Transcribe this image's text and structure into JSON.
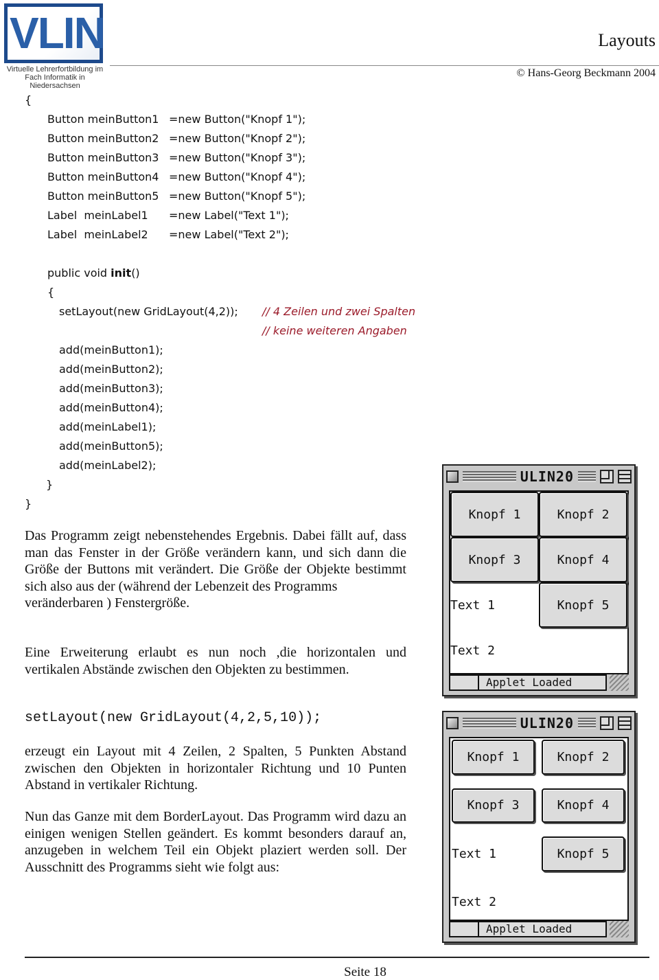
{
  "header": {
    "logo_text": "VLIN",
    "logo_sub_line1": "Virtuelle Lehrerfortbildung im",
    "logo_sub_line2": "Fach Informatik in Niedersachsen",
    "title": "Layouts",
    "copyright": "© Hans-Georg Beckmann 2004",
    "brand_color": "#1d4a8c"
  },
  "code_block_1": {
    "open_brace": "{",
    "declarations": [
      {
        "decl": "Button meinButton1",
        "init": "=new Button(\"Knopf 1\");"
      },
      {
        "decl": "Button meinButton2",
        "init": "=new Button(\"Knopf 2\");"
      },
      {
        "decl": "Button meinButton3",
        "init": "=new Button(\"Knopf 3\");"
      },
      {
        "decl": "Button meinButton4",
        "init": "=new Button(\"Knopf 4\");"
      },
      {
        "decl": "Button meinButton5",
        "init": "=new Button(\"Knopf 5\");"
      },
      {
        "decl": "Label  meinLabel1",
        "init": "=new Label(\"Text 1\");"
      },
      {
        "decl": "Label  meinLabel2",
        "init": "=new Label(\"Text 2\");"
      }
    ],
    "method_sig_prefix": "public void ",
    "method_name": "init",
    "method_sig_suffix": "()",
    "method_open": "{",
    "set_layout": "setLayout(new GridLayout(4,2));",
    "comment_1": "// 4 Zeilen und zwei Spalten",
    "comment_2": "// keine weiteren Angaben",
    "adds": [
      "add(meinButton1);",
      "add(meinButton2);",
      "add(meinButton3);",
      "add(meinButton4);",
      "add(meinLabel1);",
      "add(meinButton5);",
      "add(meinLabel2);"
    ],
    "method_close": "}",
    "close_brace": "}",
    "comment_color": "#9b1b2a"
  },
  "prose": {
    "para1": "Das Programm zeigt nebenstehendes Ergebnis. Dabei fällt auf, dass man das Fenster in der Größe verändern kann, und sich dann die Größe der Buttons mit verändert. Die Größe der Objekte bestimmt sich also aus der (während der Lebenzeit des Programms",
    "para1_last": "veränderbaren ) Fenstergröße.",
    "para2": "Eine Erweiterung  erlaubt es nun noch ,die horizontalen und vertikalen Abstände zwischen den Objekten zu bestimmen.",
    "code_line": "setLayout(new GridLayout(4,2,5,10));",
    "para3": "erzeugt ein Layout mit 4 Zeilen, 2 Spalten, 5 Punkten Abstand zwischen den Objekten in horizontaler Richtung und 10 Punten Abstand in vertikaler Richtung.",
    "para4": "Nun das Ganze mit dem BorderLayout. Das Programm wird dazu an einigen wenigen Stellen geändert. Es kommt besonders darauf an, anzugeben in welchem Teil ein Objekt plaziert werden soll. Der Ausschnitt des Programms sieht wie folgt aus:"
  },
  "applet_windows": [
    {
      "title": "ULIN20",
      "cells": [
        "Knopf 1",
        "Knopf 2",
        "Knopf 3",
        "Knopf 4",
        "Text 1",
        "Knopf 5",
        "Text 2",
        ""
      ],
      "status": "Applet Loaded"
    },
    {
      "title": "ULIN20",
      "cells": [
        "Knopf 1",
        "Knopf 2",
        "Knopf 3",
        "Knopf 4",
        "Text 1",
        "Knopf 5",
        "Text 2",
        ""
      ],
      "status": "Applet Loaded"
    }
  ],
  "footer": {
    "page_label": "Seite  18"
  }
}
